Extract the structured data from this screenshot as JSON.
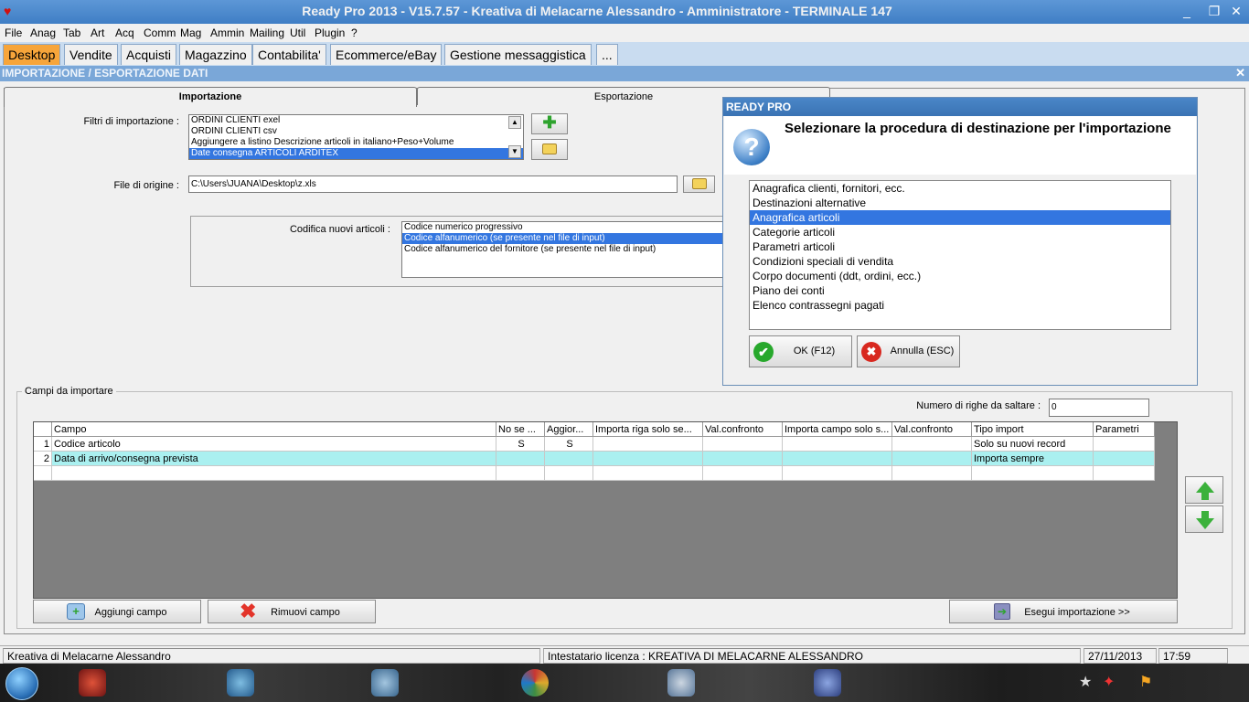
{
  "window": {
    "title": "Ready Pro 2013 - V15.7.57 - Kreativa di Melacarne Alessandro - Amministratore - TERMINALE 147",
    "minimize": "_",
    "restore": "❐",
    "close": "✕"
  },
  "menu": [
    "File",
    "Anag",
    "Tab",
    "Art",
    "Acq",
    "Comm",
    "Mag",
    "Ammin",
    "Mailing",
    "Util",
    "Plugin",
    "?"
  ],
  "module_tabs": [
    "Desktop",
    "Vendite",
    "Acquisti",
    "Magazzino",
    "Contabilita'",
    "Ecommerce/eBay",
    "Gestione messaggistica",
    "..."
  ],
  "page_title": "IMPORTAZIONE / ESPORTAZIONE DATI",
  "page_close": "✕",
  "inner_tabs": {
    "import": "Importazione",
    "export": "Esportazione"
  },
  "import_filters": {
    "label": "Filtri di importazione :",
    "items": [
      "ORDINI CLIENTI exel",
      "ORDINI CLIENTI csv",
      "Aggiungere a listino Descrizione articoli in italiano+Peso+Volume",
      "Date consegna ARTICOLI ARDITEX"
    ],
    "selected_index": 3
  },
  "source_file": {
    "label": "File di origine :",
    "value": "C:\\Users\\JUANA\\Desktop\\z.xls"
  },
  "new_code": {
    "label": "Codifica nuovi articoli :",
    "items": [
      "Codice numerico progressivo",
      "Codice alfanumerico (se presente nel file di input)",
      "Codice alfanumerico del fornitore (se presente nel file di input)"
    ],
    "selected_index": 1
  },
  "fields_section": {
    "legend": "Campi da importare",
    "skip_rows_label": "Numero di righe da saltare :",
    "skip_rows_value": "0"
  },
  "grid": {
    "columns": [
      "Campo",
      "No se ...",
      "Aggior...",
      "Importa riga solo se...",
      "Val.confronto",
      "Importa campo solo s...",
      "Val.confronto",
      "Tipo import",
      "Parametri"
    ],
    "rows": [
      {
        "num": "1",
        "cells": [
          "Codice articolo",
          "S",
          "S",
          "",
          "",
          "",
          "",
          "Solo su nuovi record",
          ""
        ]
      },
      {
        "num": "2",
        "cells": [
          "Data di arrivo/consegna prevista",
          "",
          "",
          "",
          "",
          "",
          "",
          "Importa sempre",
          ""
        ]
      }
    ]
  },
  "buttons": {
    "add_field": "Aggiungi campo",
    "remove_field": "Rimuovi campo",
    "run_import": "Esegui importazione >>"
  },
  "dialog": {
    "title": "READY PRO",
    "message": "Selezionare la procedura di destinazione per l'importazione",
    "icon_glyph": "?",
    "items": [
      "Anagrafica clienti, fornitori, ecc.",
      "Destinazioni alternative",
      "Anagrafica articoli",
      "Categorie articoli",
      "Parametri articoli",
      "Condizioni speciali di vendita",
      "Corpo documenti (ddt, ordini, ecc.)",
      "Piano dei conti",
      "Elenco contrassegni pagati"
    ],
    "selected_index": 2,
    "ok_label": "OK (F12)",
    "cancel_label": "Annulla (ESC)"
  },
  "status": {
    "company": "Kreativa di Melacarne Alessandro",
    "license": "Intestatario licenza : KREATIVA DI MELACARNE ALESSANDRO",
    "date": "27/11/2013",
    "time": "17:59"
  },
  "colors": {
    "active_tab": "#f7a53a",
    "selection": "#3376e0",
    "highlight_row": "#aaf0f0",
    "title_bar": "#3f7ec5"
  }
}
